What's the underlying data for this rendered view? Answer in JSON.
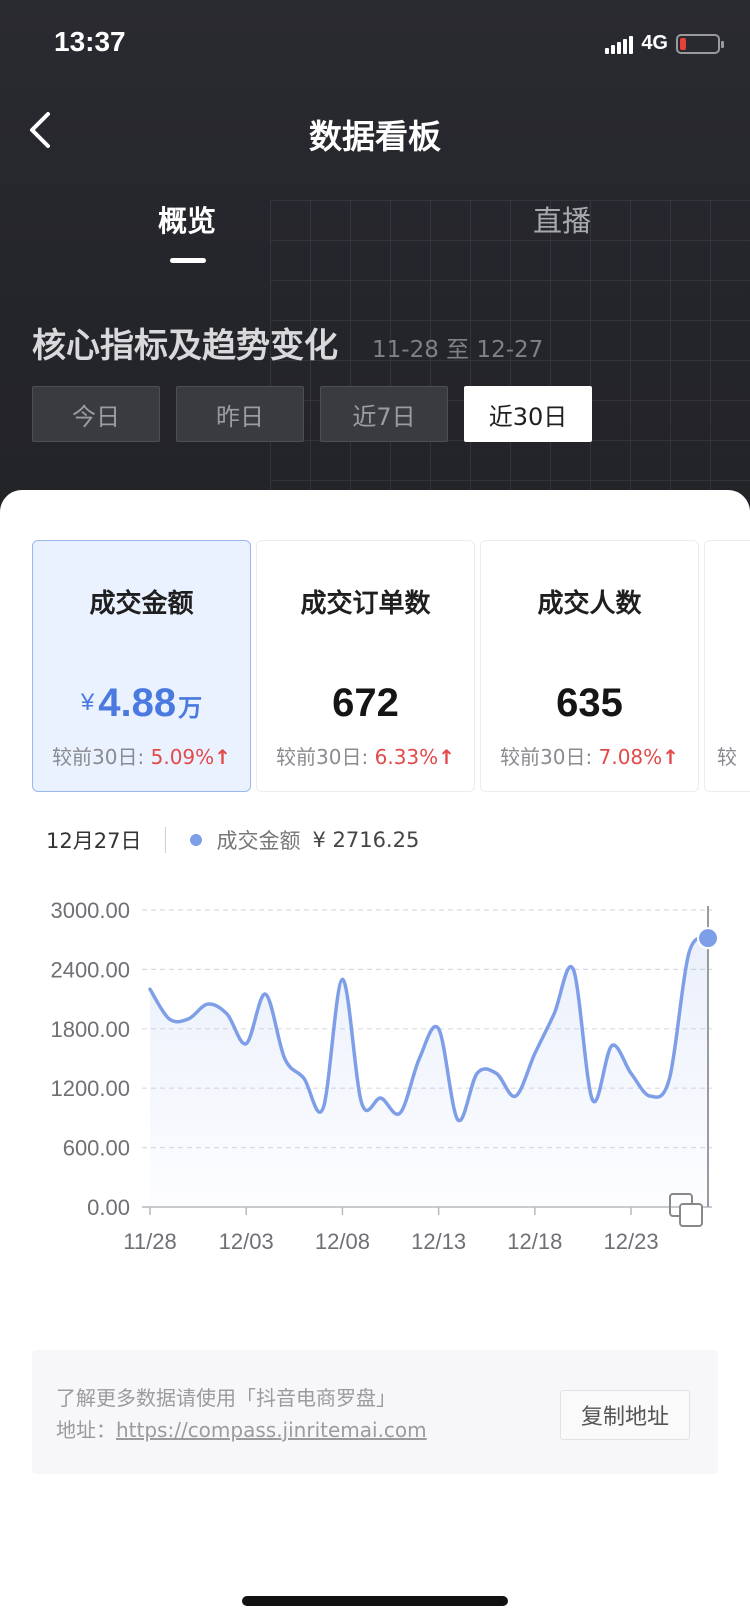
{
  "status_bar": {
    "time": "13:37",
    "network": "4G"
  },
  "nav": {
    "title": "数据看板"
  },
  "tabs": [
    {
      "label": "概览",
      "active": true
    },
    {
      "label": "直播",
      "active": false
    }
  ],
  "section": {
    "title": "核心指标及趋势变化",
    "date_range": "11-28 至 12-27"
  },
  "range_buttons": [
    {
      "label": "今日",
      "active": false
    },
    {
      "label": "昨日",
      "active": false
    },
    {
      "label": "近7日",
      "active": false
    },
    {
      "label": "近30日",
      "active": true
    }
  ],
  "metrics": [
    {
      "name": "成交金额",
      "currency": "¥",
      "value": "4.88",
      "unit": "万",
      "compare_label": "较前30日:",
      "compare_value": "5.09%",
      "active": true
    },
    {
      "name": "成交订单数",
      "currency": "",
      "value": "672",
      "unit": "",
      "compare_label": "较前30日:",
      "compare_value": "6.33%",
      "active": false
    },
    {
      "name": "成交人数",
      "currency": "",
      "value": "635",
      "unit": "",
      "compare_label": "较前30日:",
      "compare_value": "7.08%",
      "active": false
    },
    {
      "name": "",
      "currency": "",
      "value": "",
      "unit": "",
      "compare_label": "较",
      "compare_value": "",
      "active": false
    }
  ],
  "legend": {
    "date": "12月27日",
    "series_name": "成交金额",
    "series_value": "¥ 2716.25"
  },
  "colors": {
    "accent": "#4a7ae0",
    "line": "#7e9fe8",
    "increase": "#e24a4a"
  },
  "chart_data": {
    "type": "line",
    "x": [
      "11/28",
      "11/29",
      "11/30",
      "12/01",
      "12/02",
      "12/03",
      "12/04",
      "12/05",
      "12/06",
      "12/07",
      "12/08",
      "12/09",
      "12/10",
      "12/11",
      "12/12",
      "12/13",
      "12/14",
      "12/15",
      "12/16",
      "12/17",
      "12/18",
      "12/19",
      "12/20",
      "12/21",
      "12/22",
      "12/23",
      "12/24",
      "12/25",
      "12/26",
      "12/27"
    ],
    "series": [
      {
        "name": "成交金额",
        "values": [
          2200,
          1900,
          1900,
          2050,
          1950,
          1650,
          2150,
          1500,
          1300,
          1000,
          2300,
          1050,
          1100,
          950,
          1500,
          1800,
          880,
          1350,
          1350,
          1120,
          1550,
          1950,
          2400,
          1080,
          1630,
          1350,
          1120,
          1300,
          2560,
          2716.25
        ]
      }
    ],
    "x_tick_labels": [
      "11/28",
      "12/03",
      "12/08",
      "12/13",
      "12/18",
      "12/23"
    ],
    "y_tick_labels": [
      "0.00",
      "600.00",
      "1200.00",
      "1800.00",
      "2400.00",
      "3000.00"
    ],
    "ylim": [
      0,
      3000
    ],
    "grid": true
  },
  "info": {
    "line1": "了解更多数据请使用「抖音电商罗盘」",
    "address_label": "地址：",
    "address_url": "https://compass.jinritemai.com",
    "copy_button": "复制地址"
  },
  "icons": {
    "back": "chevron-left-icon",
    "copy": "copy-icon",
    "arrow": "arrow-up-icon"
  }
}
